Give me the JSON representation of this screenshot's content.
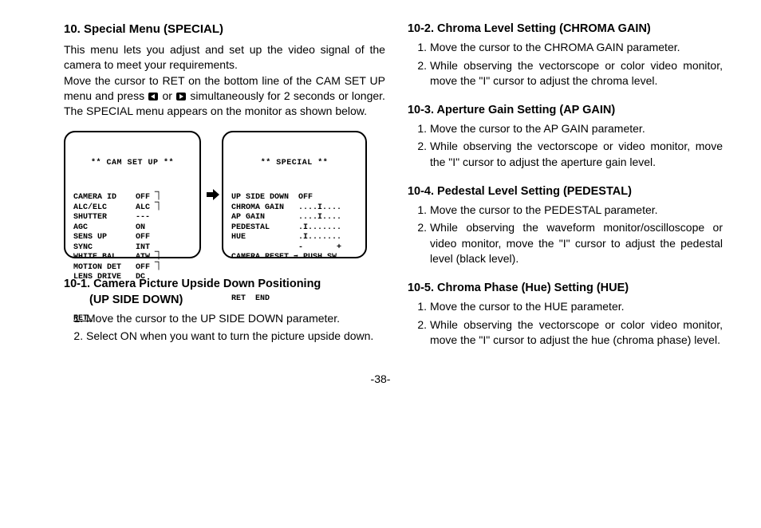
{
  "pageNum": "-38-",
  "left": {
    "heading": "10. Special Menu (SPECIAL)",
    "para1": "This menu lets you adjust and set up the video signal of the camera to meet your requirements.",
    "para2a": "Move the cursor to RET on the bottom line of the CAM SET UP menu and press ",
    "para2b": " or ",
    "para2c": " simultaneously for 2 seconds or longer. The SPECIAL menu appears on the monitor as shown below.",
    "screen1": {
      "title": "** CAM SET UP **",
      "lines": "CAMERA ID    OFF ⏋\nALC/ELC      ALC ⏋\nSHUTTER      ---\nAGC          ON\nSENS UP      OFF\nSYNC         INT\nWHITE BAL    ATW ⏋\nMOTION DET   OFF ⏋\nLENS DRIVE   DC",
      "ret": "RET."
    },
    "screen2": {
      "title": "** SPECIAL **",
      "lines": "UP SIDE DOWN  OFF\nCHROMA GAIN   ....I....\nAP GAIN       ....I....\nPEDESTAL      .I.......\nHUE           .I.......\n              -       +\nCAMERA RESET ➡ PUSH SW",
      "ret": "RET  END"
    },
    "sec1": {
      "heading": "10-1. Camera Picture Upside Down Positioning",
      "headingLine2": "(UP SIDE DOWN)",
      "step1": "Move the cursor to the UP SIDE DOWN parameter.",
      "step2": "Select ON when you want to turn the picture upside down."
    }
  },
  "right": {
    "sec2": {
      "heading": "10-2. Chroma Level Setting (CHROMA GAIN)",
      "step1": "Move the cursor to the CHROMA GAIN parameter.",
      "step2": "While observing the vectorscope or color video monitor, move the \"I\" cursor to adjust the chroma level."
    },
    "sec3": {
      "heading": "10-3. Aperture Gain Setting (AP GAIN)",
      "step1": "Move the cursor to the AP GAIN parameter.",
      "step2": "While observing the vectorscope or video monitor, move the \"I\" cursor to adjust the aperture gain level."
    },
    "sec4": {
      "heading": "10-4. Pedestal Level Setting (PEDESTAL)",
      "step1": "Move the cursor to the PEDESTAL parameter.",
      "step2": "While observing the waveform monitor/oscillo­scope or video monitor, move the \"I\" cursor to adjust the pedestal level (black level)."
    },
    "sec5": {
      "heading": "10-5. Chroma Phase (Hue) Setting (HUE)",
      "step1": "Move the cursor to the HUE parameter.",
      "step2": "While observing the vectorscope or color video monitor, move the \"I\" cursor to adjust the hue (chroma phase) level."
    }
  }
}
